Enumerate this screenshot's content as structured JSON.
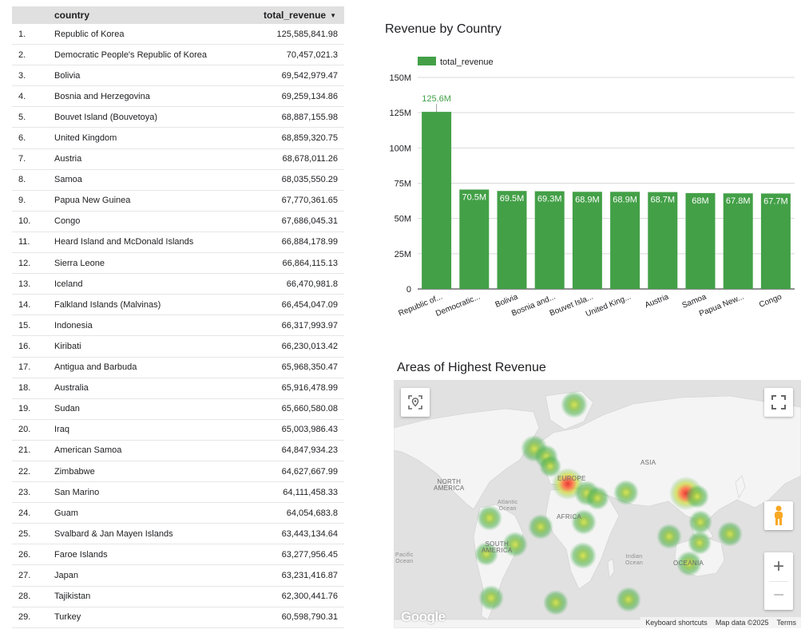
{
  "table": {
    "headers": {
      "country": "country",
      "revenue": "total_revenue"
    },
    "rows": [
      {
        "idx": "1.",
        "country": "Republic of Korea",
        "revenue": "125,585,841.98"
      },
      {
        "idx": "2.",
        "country": "Democratic People's Republic of Korea",
        "revenue": "70,457,021.3"
      },
      {
        "idx": "3.",
        "country": "Bolivia",
        "revenue": "69,542,979.47"
      },
      {
        "idx": "4.",
        "country": "Bosnia and Herzegovina",
        "revenue": "69,259,134.86"
      },
      {
        "idx": "5.",
        "country": "Bouvet Island (Bouvetoya)",
        "revenue": "68,887,155.98"
      },
      {
        "idx": "6.",
        "country": "United Kingdom",
        "revenue": "68,859,320.75"
      },
      {
        "idx": "7.",
        "country": "Austria",
        "revenue": "68,678,011.26"
      },
      {
        "idx": "8.",
        "country": "Samoa",
        "revenue": "68,035,550.29"
      },
      {
        "idx": "9.",
        "country": "Papua New Guinea",
        "revenue": "67,770,361.65"
      },
      {
        "idx": "10.",
        "country": "Congo",
        "revenue": "67,686,045.31"
      },
      {
        "idx": "11.",
        "country": "Heard Island and McDonald Islands",
        "revenue": "66,884,178.99"
      },
      {
        "idx": "12.",
        "country": "Sierra Leone",
        "revenue": "66,864,115.13"
      },
      {
        "idx": "13.",
        "country": "Iceland",
        "revenue": "66,470,981.8"
      },
      {
        "idx": "14.",
        "country": "Falkland Islands (Malvinas)",
        "revenue": "66,454,047.09"
      },
      {
        "idx": "15.",
        "country": "Indonesia",
        "revenue": "66,317,993.97"
      },
      {
        "idx": "16.",
        "country": "Kiribati",
        "revenue": "66,230,013.42"
      },
      {
        "idx": "17.",
        "country": "Antigua and Barbuda",
        "revenue": "65,968,350.47"
      },
      {
        "idx": "18.",
        "country": "Australia",
        "revenue": "65,916,478.99"
      },
      {
        "idx": "19.",
        "country": "Sudan",
        "revenue": "65,660,580.08"
      },
      {
        "idx": "20.",
        "country": "Iraq",
        "revenue": "65,003,986.43"
      },
      {
        "idx": "21.",
        "country": "American Samoa",
        "revenue": "64,847,934.23"
      },
      {
        "idx": "22.",
        "country": "Zimbabwe",
        "revenue": "64,627,667.99"
      },
      {
        "idx": "23.",
        "country": "San Marino",
        "revenue": "64,111,458.33"
      },
      {
        "idx": "24.",
        "country": "Guam",
        "revenue": "64,054,683.8"
      },
      {
        "idx": "25.",
        "country": "Svalbard & Jan Mayen Islands",
        "revenue": "63,443,134.64"
      },
      {
        "idx": "26.",
        "country": "Faroe Islands",
        "revenue": "63,277,956.45"
      },
      {
        "idx": "27.",
        "country": "Japan",
        "revenue": "63,231,416.87"
      },
      {
        "idx": "28.",
        "country": "Tajikistan",
        "revenue": "62,300,441.76"
      },
      {
        "idx": "29.",
        "country": "Turkey",
        "revenue": "60,598,790.31"
      }
    ]
  },
  "chart_data": {
    "type": "bar",
    "title": "Revenue by Country",
    "legend": {
      "label": "total_revenue",
      "position": "top-left"
    },
    "categories": [
      "Republic of...",
      "Democratic...",
      "Bolivia",
      "Bosnia and...",
      "Bouvet Isla...",
      "United King...",
      "Austria",
      "Samoa",
      "Papua New...",
      "Congo"
    ],
    "values": [
      125.6,
      70.5,
      69.5,
      69.3,
      68.9,
      68.9,
      68.7,
      68.0,
      67.8,
      67.7
    ],
    "value_labels": [
      "125.6M",
      "70.5M",
      "69.5M",
      "69.3M",
      "68.9M",
      "68.9M",
      "68.7M",
      "68M",
      "67.8M",
      "67.7M"
    ],
    "ylim": [
      0,
      150
    ],
    "yticks": [
      0,
      25,
      50,
      75,
      100,
      125,
      150
    ],
    "ytick_labels": [
      "0",
      "25M",
      "50M",
      "75M",
      "100M",
      "125M",
      "150M"
    ],
    "grid": true,
    "colors": {
      "bar": "#43a047",
      "first_label": "#43a047",
      "inner_label": "#ffffff"
    }
  },
  "map": {
    "title": "Areas of Highest Revenue",
    "labels": {
      "north_america": "NORTH\nAMERICA",
      "south_america": "SOUTH\nAMERICA",
      "europe": "EUROPE",
      "asia": "ASIA",
      "africa": "AFRICA",
      "oceania": "OCEANIA",
      "atlantic": "Atlantic\nOcean",
      "pacific": "Pacific\nOcean",
      "indian": "Indian\nOcean"
    },
    "logo": "Google",
    "footer": {
      "shortcuts": "Keyboard shortcuts",
      "data": "Map data ©2025",
      "terms": "Terms"
    },
    "controls": {
      "zoom_in": "+",
      "zoom_out": "−"
    }
  }
}
